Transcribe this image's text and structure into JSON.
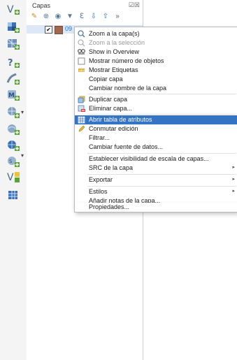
{
  "panel": {
    "title": "Capas",
    "controls": "☑☒"
  },
  "layer": {
    "name": "09"
  },
  "context_menu": {
    "items": [
      {
        "label": "Zoom a la capa(s)",
        "state": "normal"
      },
      {
        "label": "Zoom a la selección",
        "state": "disabled"
      },
      {
        "label": "Show in Overview",
        "state": "normal"
      },
      {
        "label": "Mostrar número de objetos",
        "state": "normal"
      },
      {
        "label": "Mostrar Etiquetas",
        "state": "normal"
      },
      {
        "label": "Copiar capa",
        "state": "normal"
      },
      {
        "label": "Cambiar nombre de la capa",
        "state": "normal"
      },
      {
        "label": "Duplicar capa",
        "state": "normal"
      },
      {
        "label": "Eliminar capa...",
        "state": "normal"
      },
      {
        "label": "Abrir tabla de atributos",
        "state": "highlighted"
      },
      {
        "label": "Conmutar edición",
        "state": "normal"
      },
      {
        "label": "Filtrar...",
        "state": "normal"
      },
      {
        "label": "Cambiar fuente de datos...",
        "state": "normal"
      },
      {
        "label": "Establecer visibilidad de escala de capas...",
        "state": "normal"
      },
      {
        "label": "SRC de la capa",
        "state": "normal"
      },
      {
        "label": "Exportar",
        "state": "normal"
      },
      {
        "label": "Estilos",
        "state": "normal"
      },
      {
        "label": "Añadir notas de la capa...",
        "state": "normal"
      },
      {
        "label": "Propiedades...",
        "state": "normal"
      }
    ]
  },
  "colors": {
    "highlight": "#3574c4",
    "layer_swatch": "#a0684f",
    "icon_green": "#5aa33a",
    "icon_blue": "#3b6fb6"
  }
}
